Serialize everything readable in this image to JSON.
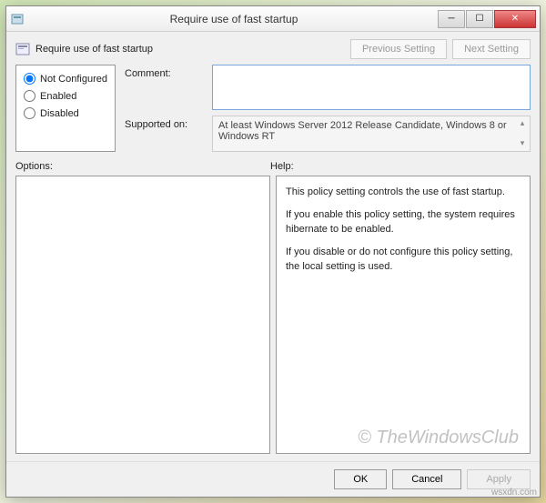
{
  "window": {
    "title": "Require use of fast startup"
  },
  "header": {
    "policy_name": "Require use of fast startup",
    "prev_setting": "Previous Setting",
    "next_setting": "Next Setting"
  },
  "radios": {
    "not_configured": "Not Configured",
    "enabled": "Enabled",
    "disabled": "Disabled"
  },
  "fields": {
    "comment_label": "Comment:",
    "comment_value": "",
    "supported_label": "Supported on:",
    "supported_value": "At least Windows Server 2012 Release Candidate, Windows 8 or Windows RT"
  },
  "labels": {
    "options": "Options:",
    "help": "Help:"
  },
  "help": {
    "p1": "This policy setting controls the use of fast startup.",
    "p2": "If you enable this policy setting, the system requires hibernate to be enabled.",
    "p3": "If you disable or do not configure this policy setting, the local setting is used."
  },
  "footer": {
    "ok": "OK",
    "cancel": "Cancel",
    "apply": "Apply"
  },
  "watermark": {
    "main": "© TheWindowsClub",
    "site": "wsxdn.com"
  }
}
